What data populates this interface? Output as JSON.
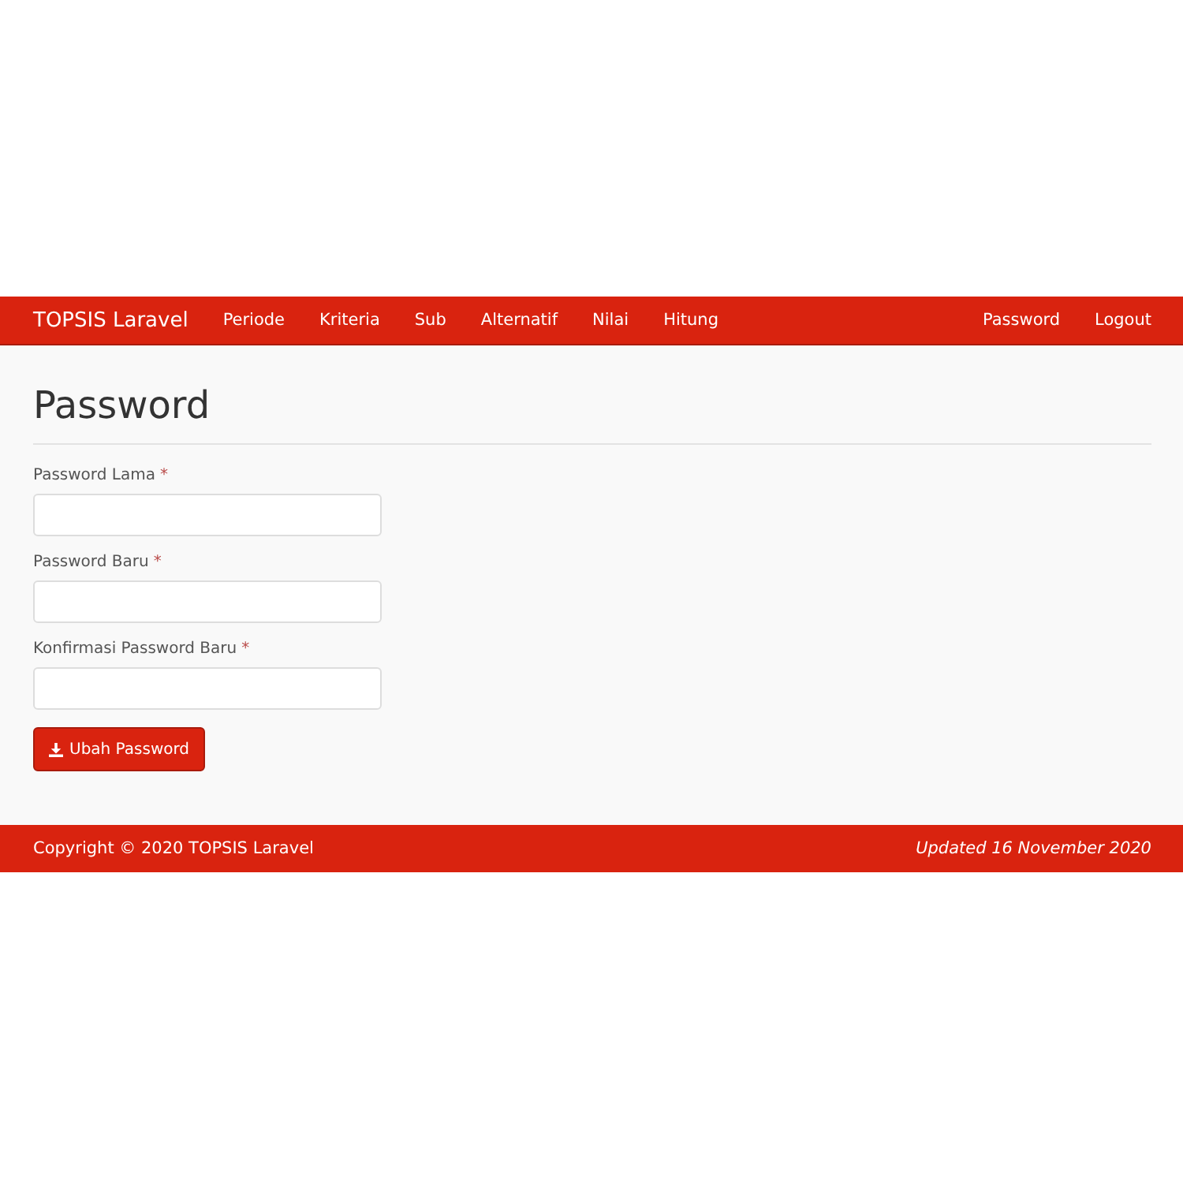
{
  "navbar": {
    "brand": "TOPSIS Laravel",
    "items": [
      {
        "label": "Periode"
      },
      {
        "label": "Kriteria"
      },
      {
        "label": "Sub"
      },
      {
        "label": "Alternatif"
      },
      {
        "label": "Nilai"
      },
      {
        "label": "Hitung"
      }
    ],
    "right_items": [
      {
        "label": "Password"
      },
      {
        "label": "Logout"
      }
    ]
  },
  "page": {
    "title": "Password"
  },
  "form": {
    "fields": [
      {
        "label": "Password Lama",
        "required_mark": "*"
      },
      {
        "label": "Password Baru",
        "required_mark": "*"
      },
      {
        "label": "Konfirmasi Password Baru",
        "required_mark": "*"
      }
    ],
    "submit": {
      "label": "Ubah Password"
    }
  },
  "footer": {
    "copyright": "Copyright © 2020 TOPSIS Laravel",
    "updated": "Updated 16 November 2020"
  }
}
